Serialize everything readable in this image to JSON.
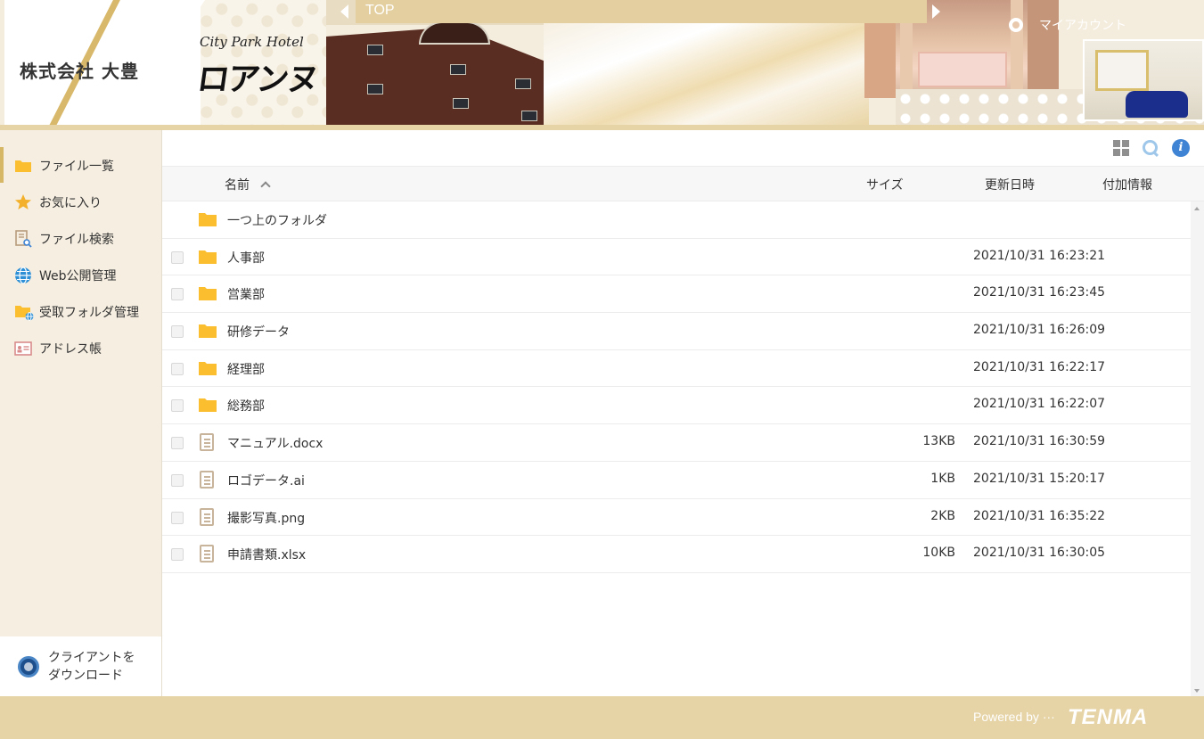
{
  "header": {
    "company_name": "株式会社 大豊",
    "brand_script": "City Park Hotel",
    "brand_logo": "ロアンヌ",
    "topbar_label": "TOP",
    "my_account_label": "マイアカウント"
  },
  "sidebar": {
    "items": [
      {
        "label": "ファイル一覧",
        "icon": "folder-icon"
      },
      {
        "label": "お気に入り",
        "icon": "star-icon"
      },
      {
        "label": "ファイル検索",
        "icon": "file-search-icon"
      },
      {
        "label": "Web公開管理",
        "icon": "globe-icon"
      },
      {
        "label": "受取フォルダ管理",
        "icon": "receive-folder-icon"
      },
      {
        "label": "アドレス帳",
        "icon": "address-book-icon"
      }
    ],
    "client_download_line1": "クライアントを",
    "client_download_line2": "ダウンロード"
  },
  "toolbar": {
    "info_glyph": "i"
  },
  "table": {
    "headers": {
      "name": "名前",
      "size": "サイズ",
      "date": "更新日時",
      "info": "付加情報"
    },
    "parent_folder": "一つ上のフォルダ",
    "rows": [
      {
        "name": "人事部",
        "type": "folder",
        "size": "",
        "date": "2021/10/31 16:23:21"
      },
      {
        "name": "営業部",
        "type": "folder",
        "size": "",
        "date": "2021/10/31 16:23:45"
      },
      {
        "name": "研修データ",
        "type": "folder",
        "size": "",
        "date": "2021/10/31 16:26:09"
      },
      {
        "name": "経理部",
        "type": "folder",
        "size": "",
        "date": "2021/10/31 16:22:17"
      },
      {
        "name": "総務部",
        "type": "folder",
        "size": "",
        "date": "2021/10/31 16:22:07"
      },
      {
        "name": "マニュアル.docx",
        "type": "file",
        "size": "13KB",
        "date": "2021/10/31 16:30:59"
      },
      {
        "name": "ロゴデータ.ai",
        "type": "file",
        "size": "1KB",
        "date": "2021/10/31 15:20:17"
      },
      {
        "name": "撮影写真.png",
        "type": "file",
        "size": "2KB",
        "date": "2021/10/31 16:35:22"
      },
      {
        "name": "申請書類.xlsx",
        "type": "file",
        "size": "10KB",
        "date": "2021/10/31 16:30:05"
      }
    ]
  },
  "footer": {
    "powered_by": "Powered by ···",
    "brand": "TENMA"
  },
  "colors": {
    "accent_gold": "#e6d3a6",
    "sidebar_bg": "#f6eee0",
    "folder_yellow": "#fbbe2e",
    "info_blue": "#3f84d4"
  }
}
